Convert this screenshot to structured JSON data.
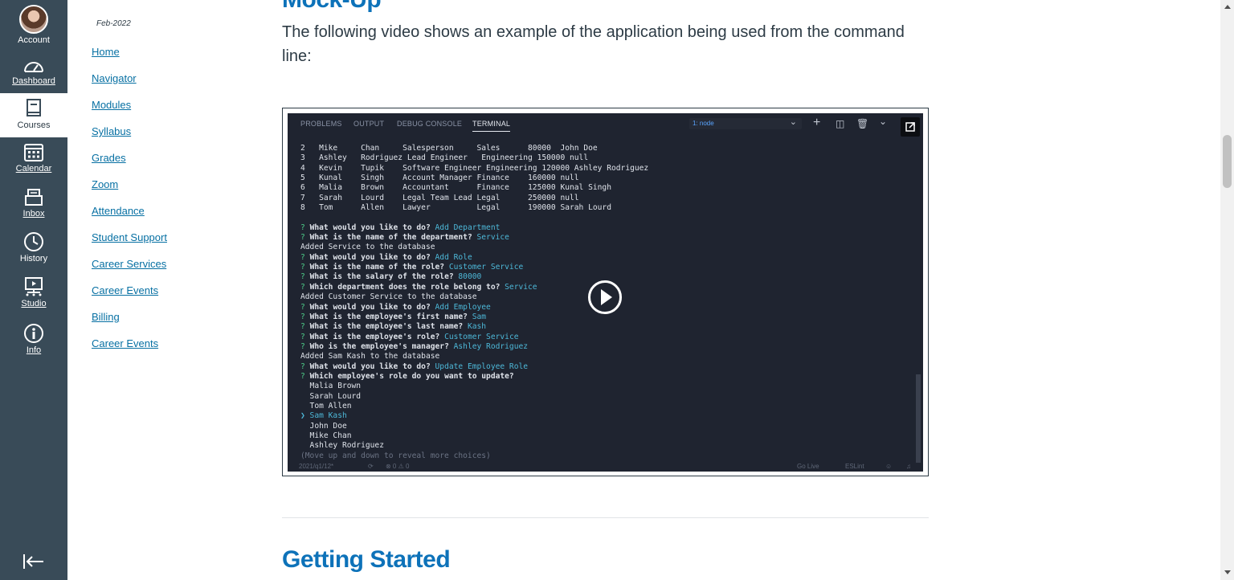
{
  "global_nav": {
    "account": "Account",
    "dashboard": "Dashboard",
    "courses": "Courses",
    "calendar": "Calendar",
    "inbox": "Inbox",
    "history": "History",
    "studio": "Studio",
    "info": "Info"
  },
  "course_nav": {
    "term": "Feb-2022",
    "links": [
      "Home",
      "Navigator",
      "Modules",
      "Syllabus",
      "Grades",
      "Zoom",
      "Attendance",
      "Student Support",
      "Career Services",
      "Career Events",
      "Billing",
      "Career Events"
    ]
  },
  "content": {
    "section_title": "Mock-Up",
    "intro": "The following video shows an example of the application being used from the command line:",
    "next_title": "Getting Started"
  },
  "video": {
    "tabs": [
      "PROBLEMS",
      "OUTPUT",
      "DEBUG CONSOLE",
      "TERMINAL"
    ],
    "active_tab": "TERMINAL",
    "terminal_select": "1: node",
    "status_left": [
      "2021/q1/12*",
      "⊗ 0 ⚠ 0"
    ],
    "status_right": [
      "Go Live",
      "ESLint"
    ]
  },
  "terminal_rows": [
    [
      "2",
      "Mike",
      "Chan",
      "Salesperson",
      "Sales",
      "80000",
      "John Doe"
    ],
    [
      "3",
      "Ashley",
      "Rodriguez",
      "Lead Engineer",
      "Engineering",
      "150000",
      "null"
    ],
    [
      "4",
      "Kevin",
      "Tupik",
      "Software Engineer",
      "Engineering",
      "120000",
      "Ashley Rodriguez"
    ],
    [
      "5",
      "Kunal",
      "Singh",
      "Account Manager",
      "Finance",
      "160000",
      "null"
    ],
    [
      "6",
      "Malia",
      "Brown",
      "Accountant",
      "Finance",
      "125000",
      "Kunal Singh"
    ],
    [
      "7",
      "Sarah",
      "Lourd",
      "Legal Team Lead",
      "Legal",
      "250000",
      "null"
    ],
    [
      "8",
      "Tom",
      "Allen",
      "Lawyer",
      "Legal",
      "190000",
      "Sarah Lourd"
    ]
  ],
  "terminal_log": [
    {
      "kind": "qa",
      "q": "What would you like to do?",
      "a": "Add Department"
    },
    {
      "kind": "qa",
      "q": "What is the name of the department?",
      "a": "Service"
    },
    {
      "kind": "text",
      "t": "Added Service to the database"
    },
    {
      "kind": "qa",
      "q": "What would you like to do?",
      "a": "Add Role"
    },
    {
      "kind": "qa",
      "q": "What is the name of the role?",
      "a": "Customer Service"
    },
    {
      "kind": "qa",
      "q": "What is the salary of the role?",
      "a": "80000"
    },
    {
      "kind": "qa",
      "q": "Which department does the role belong to?",
      "a": "Service"
    },
    {
      "kind": "text",
      "t": "Added Customer Service to the database"
    },
    {
      "kind": "qa",
      "q": "What would you like to do?",
      "a": "Add Employee"
    },
    {
      "kind": "qa",
      "q": "What is the employee's first name?",
      "a": "Sam"
    },
    {
      "kind": "qa",
      "q": "What is the employee's last name?",
      "a": "Kash"
    },
    {
      "kind": "qa",
      "q": "What is the employee's role?",
      "a": "Customer Service"
    },
    {
      "kind": "qa",
      "q": "Who is the employee's manager?",
      "a": "Ashley Rodriguez"
    },
    {
      "kind": "text",
      "t": "Added Sam Kash to the database"
    },
    {
      "kind": "qa",
      "q": "What would you like to do?",
      "a": "Update Employee Role"
    },
    {
      "kind": "qa",
      "q": "Which employee's role do you want to update?",
      "a": ""
    },
    {
      "kind": "choice",
      "t": "Malia Brown"
    },
    {
      "kind": "choice",
      "t": "Sarah Lourd"
    },
    {
      "kind": "choice",
      "t": "Tom Allen"
    },
    {
      "kind": "selected",
      "t": "Sam Kash"
    },
    {
      "kind": "choice",
      "t": "John Doe"
    },
    {
      "kind": "choice",
      "t": "Mike Chan"
    },
    {
      "kind": "choice",
      "t": "Ashley Rodriguez"
    },
    {
      "kind": "hint",
      "t": "(Move up and down to reveal more choices)"
    }
  ]
}
